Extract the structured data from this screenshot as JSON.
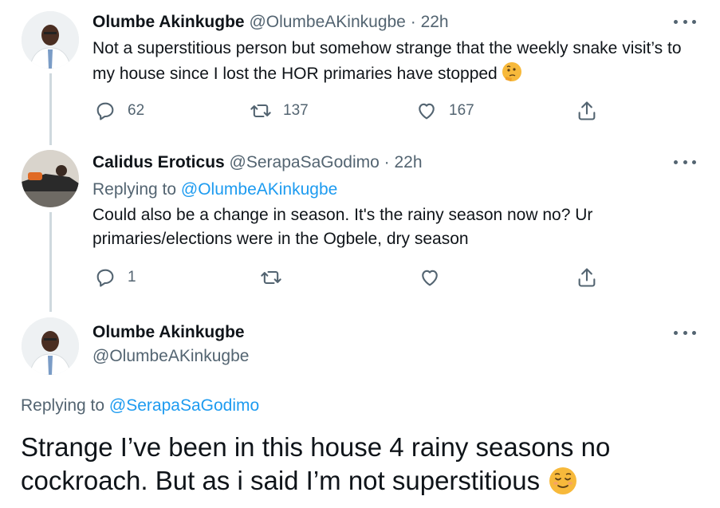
{
  "tweets": [
    {
      "name": "Olumbe Akinkugbe",
      "handle": "@OlumbeAKinkugbe",
      "dot": "·",
      "time": "22h",
      "text": "Not a superstitious person but somehow strange that the weekly snake visit’s to my house since I lost the HOR primaries have stopped",
      "emoji": "thinking-face",
      "replies": "62",
      "retweets": "137",
      "likes": "167"
    },
    {
      "name": "Calidus Eroticus",
      "handle": "@SerapaSaGodimo",
      "dot": "·",
      "time": "22h",
      "replying_label": "Replying to",
      "replying_handle": "@OlumbeAKinkugbe",
      "text": "Could also be a change in season. It's the rainy season now no? Ur primaries/elections were in the Ogbele, dry season",
      "replies": "1"
    }
  ],
  "main_tweet": {
    "name": "Olumbe Akinkugbe",
    "handle": "@OlumbeAKinkugbe",
    "replying_label": "Replying to",
    "replying_handle": "@SerapaSaGodimo",
    "text": "Strange I’ve been in this house 4 rainy seasons no cockroach. But as i said I’m not superstitious",
    "emoji": "relieved-face"
  },
  "icons": {
    "reply": "reply-icon",
    "retweet": "retweet-icon",
    "like": "heart-icon",
    "share": "share-icon",
    "more": "more-icon"
  },
  "colors": {
    "text": "#0f1419",
    "secondary": "#536471",
    "link": "#1d9bf0",
    "thread_line": "#cfd9de"
  }
}
